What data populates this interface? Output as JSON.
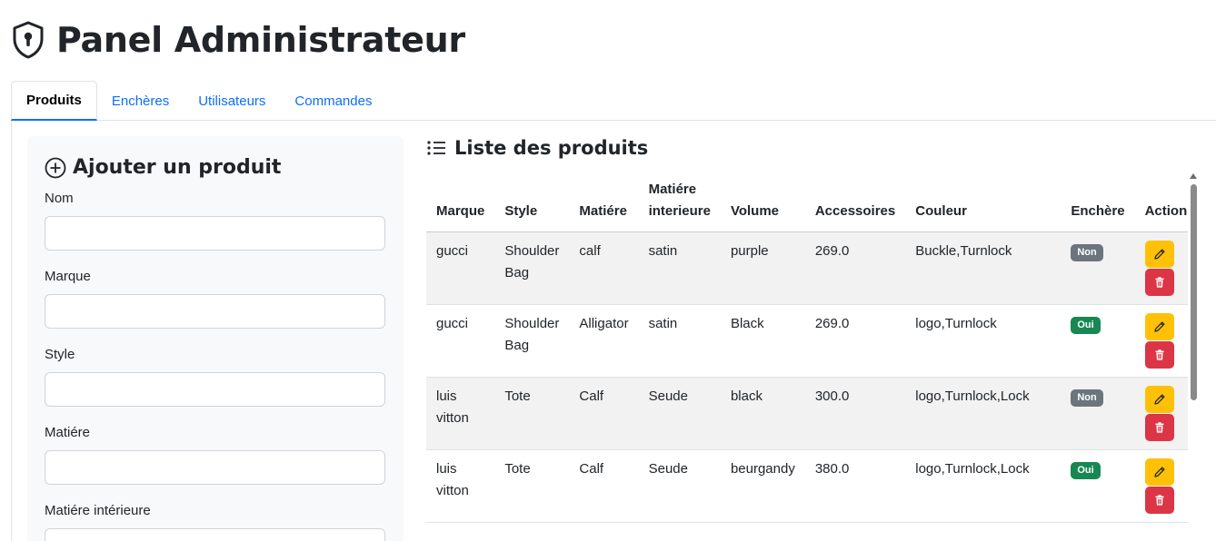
{
  "header": {
    "title": "Panel Administrateur",
    "icon": "shield-keyhole-icon"
  },
  "tabs": [
    {
      "label": "Produits",
      "active": true
    },
    {
      "label": "Enchères",
      "active": false
    },
    {
      "label": "Utilisateurs",
      "active": false
    },
    {
      "label": "Commandes",
      "active": false
    }
  ],
  "form": {
    "title": "Ajouter un produit",
    "icon": "plus-circle-icon",
    "fields": [
      {
        "label": "Nom",
        "value": ""
      },
      {
        "label": "Marque",
        "value": ""
      },
      {
        "label": "Style",
        "value": ""
      },
      {
        "label": "Matiére",
        "value": ""
      },
      {
        "label": "Matiére intérieure",
        "value": ""
      }
    ]
  },
  "list": {
    "title": "Liste des produits",
    "icon": "list-icon",
    "columns": [
      "Marque",
      "Style",
      "Matiére",
      "Matiére interieure",
      "Volume",
      "Accessoires",
      "Couleur",
      "Enchère",
      "Actions"
    ],
    "rows": [
      {
        "marque": "gucci",
        "style": "Shoulder Bag",
        "matiere": "calf",
        "matiere_interieure": "satin",
        "volume": "purple",
        "accessoires": "269.0",
        "couleur": "Buckle,Turnlock",
        "enchere": "Non"
      },
      {
        "marque": "gucci",
        "style": "Shoulder Bag",
        "matiere": "Alligator",
        "matiere_interieure": "satin",
        "volume": "Black",
        "accessoires": "269.0",
        "couleur": "logo,Turnlock",
        "enchere": "Oui"
      },
      {
        "marque": "luis vitton",
        "style": "Tote",
        "matiere": "Calf",
        "matiere_interieure": "Seude",
        "volume": "black",
        "accessoires": "300.0",
        "couleur": "logo,Turnlock,Lock",
        "enchere": "Non"
      },
      {
        "marque": "luis vitton",
        "style": "Tote",
        "matiere": "Calf",
        "matiere_interieure": "Seude",
        "volume": "beurgandy",
        "accessoires": "380.0",
        "couleur": "logo,Turnlock,Lock",
        "enchere": "Oui"
      }
    ]
  },
  "colors": {
    "primary": "#0d6efd",
    "warning": "#ffc107",
    "danger": "#dc3545",
    "success": "#198754",
    "secondary": "#6c757d"
  }
}
